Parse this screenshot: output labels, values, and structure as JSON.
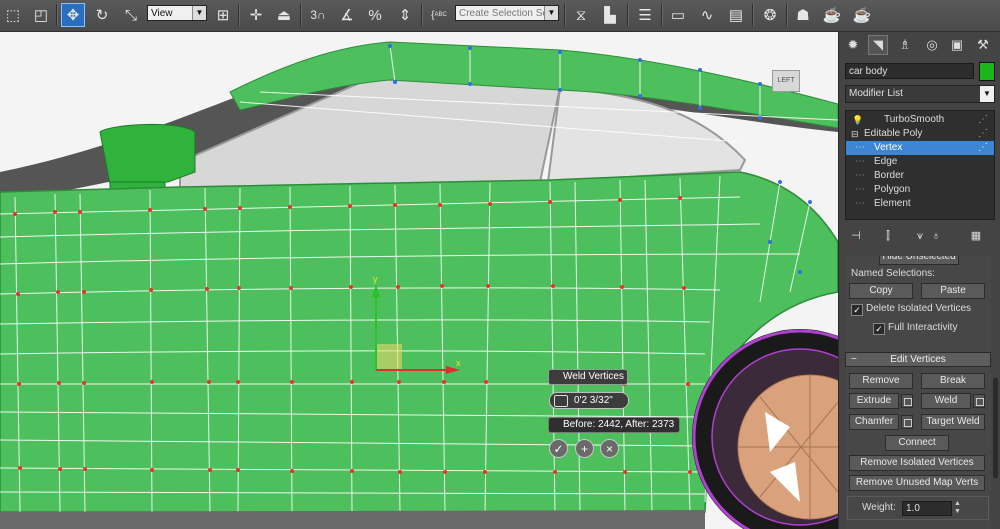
{
  "toolbar": {
    "view_select": "View",
    "selection_set_placeholder": "Create Selection Se",
    "snap_label": "3",
    "percent_label": "%",
    "abc_label": "ABC"
  },
  "viewport": {
    "view_cube_label": "LEFT",
    "caddy": {
      "title": "Weld Vertices",
      "value": "0'2 3/32\"",
      "result": "Before: 2442, After: 2373",
      "ok": "✓",
      "apply": "+",
      "cancel": "×"
    },
    "gizmo": {
      "axis_y": "y",
      "axis_x": "x"
    }
  },
  "command_panel": {
    "object_name": "car body",
    "object_color": "#1cb51c",
    "modifier_list": "Modifier List",
    "stack": [
      {
        "label": "TurboSmooth",
        "level": 0
      },
      {
        "label": "Editable Poly",
        "level": 0
      },
      {
        "label": "Vertex",
        "level": 1,
        "selected": true
      },
      {
        "label": "Edge",
        "level": 1
      },
      {
        "label": "Border",
        "level": 1
      },
      {
        "label": "Polygon",
        "level": 1
      },
      {
        "label": "Element",
        "level": 1
      }
    ],
    "selection_rollout": {
      "hide_unselected": "Hide Unselected",
      "named_selections": "Named Selections:",
      "copy": "Copy",
      "paste": "Paste",
      "delete_isolated": "Delete Isolated Vertices",
      "full_interactivity": "Full Interactivity"
    },
    "edit_vertices": {
      "title": "Edit Vertices",
      "remove": "Remove",
      "break": "Break",
      "extrude": "Extrude",
      "weld": "Weld",
      "chamfer": "Chamfer",
      "target_weld": "Target Weld",
      "connect": "Connect",
      "remove_isolated": "Remove Isolated Vertices",
      "remove_unused": "Remove Unused Map Verts",
      "weight_label": "Weight:",
      "weight_value": "1.0"
    }
  },
  "colors": {
    "mesh_green": "#4dbf5d",
    "selected_blue": "#3d86d6",
    "wheel_purple": "#b040d0"
  }
}
